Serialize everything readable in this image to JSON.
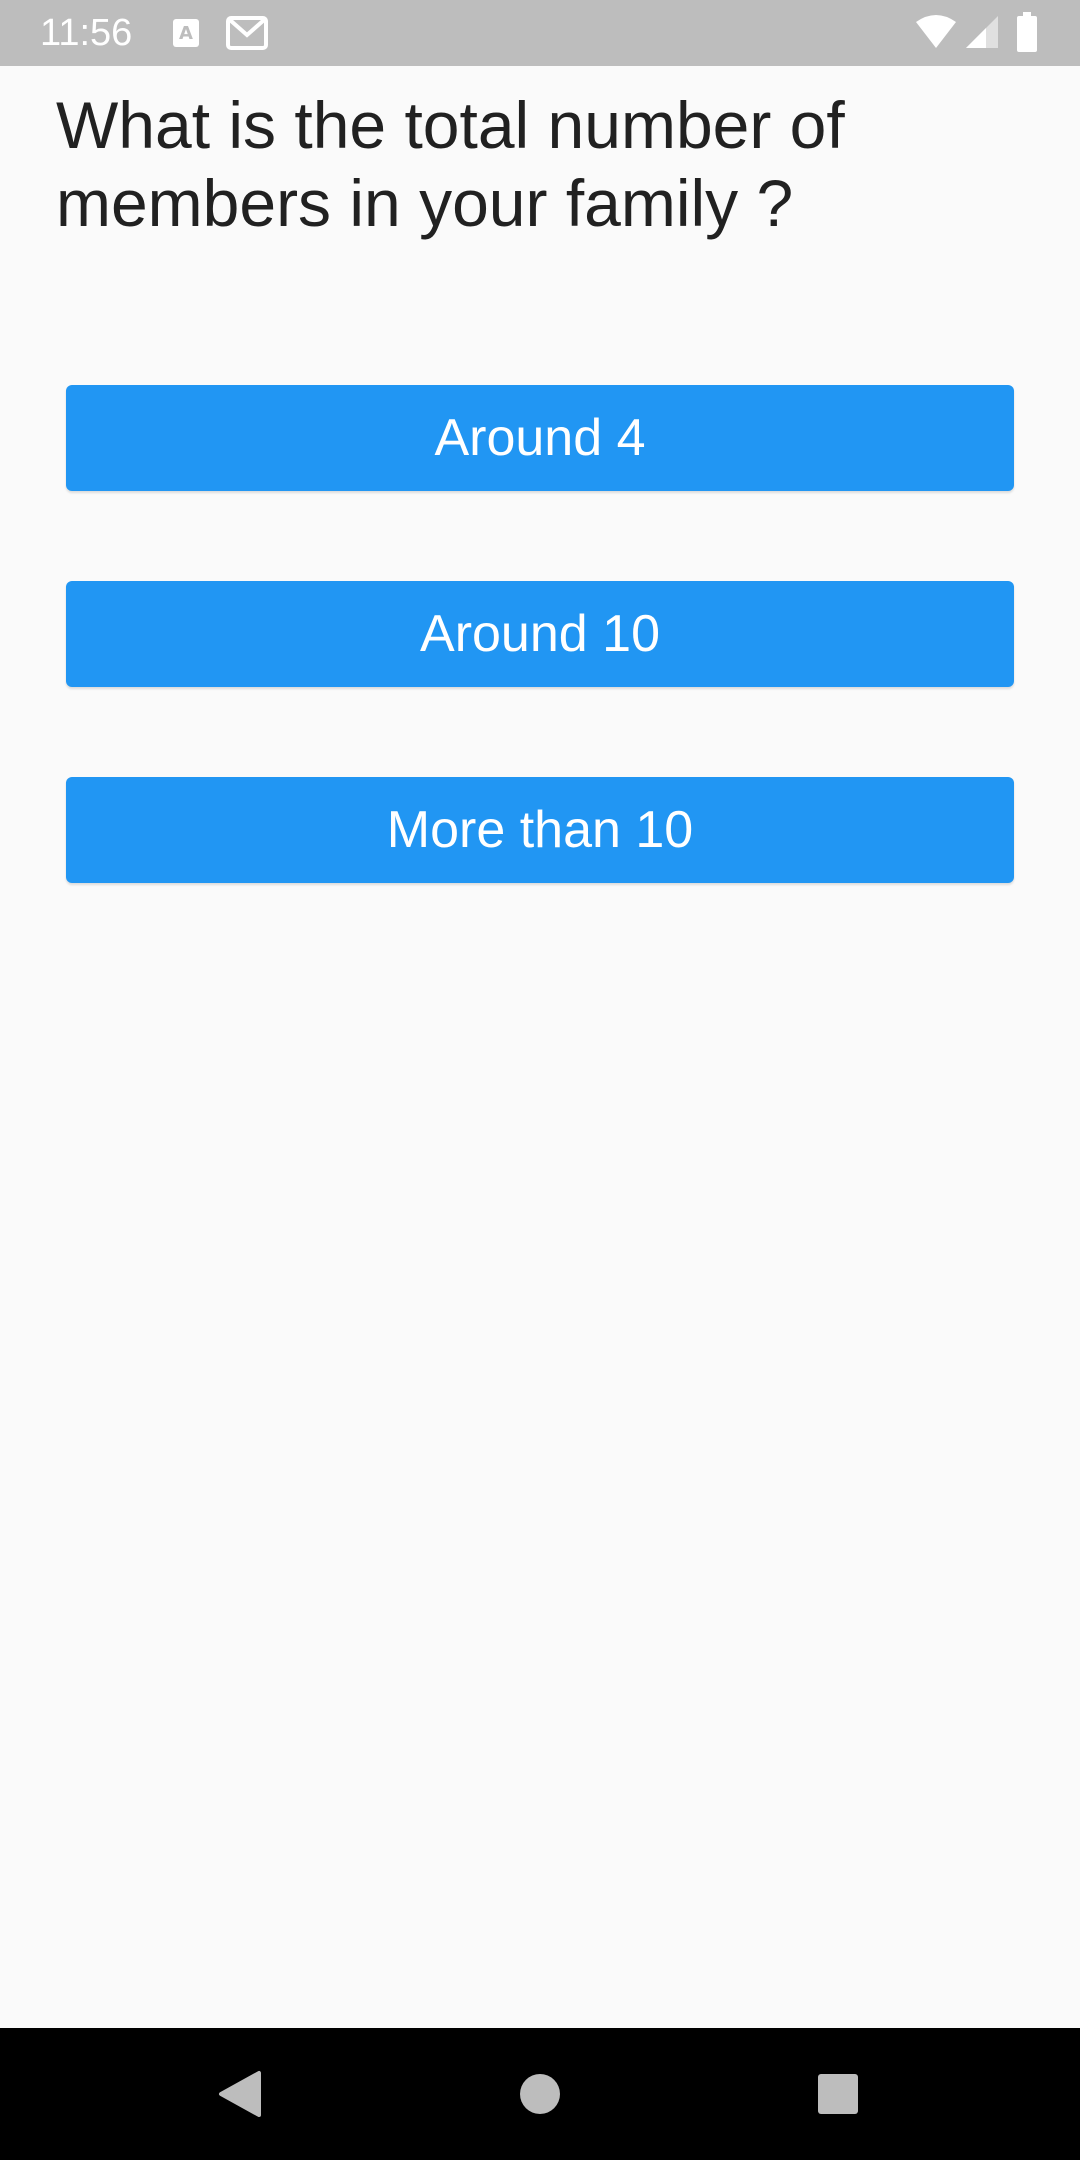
{
  "status_bar": {
    "time": "11:56",
    "notification_icons": [
      "text-format-icon",
      "gmail-icon"
    ],
    "system_icons": [
      "wifi-icon",
      "cell-signal-icon",
      "battery-icon"
    ],
    "background": "#bdbdbd"
  },
  "question": {
    "text": " What is the total number of\nmembers in your family ?"
  },
  "options": [
    {
      "label": "Around 4"
    },
    {
      "label": "Around 10"
    },
    {
      "label": "More than 10"
    }
  ],
  "nav_bar": {
    "buttons": [
      "back-icon",
      "home-icon",
      "recents-icon"
    ]
  },
  "colors": {
    "accent": "#2196f3",
    "background": "#fafafa",
    "text": "#212121"
  }
}
